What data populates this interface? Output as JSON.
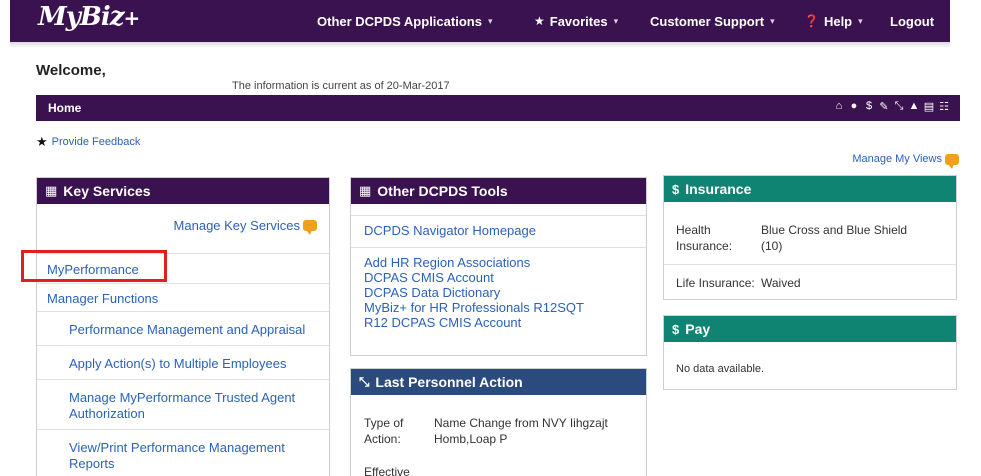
{
  "topbar": {
    "logo_main": "MyBiz",
    "logo_plus": "+",
    "menu": [
      {
        "label": "Other DCPDS Applications",
        "icon": ""
      },
      {
        "label": "Favorites",
        "icon": "star-icon"
      },
      {
        "label": "Customer Support",
        "icon": ""
      },
      {
        "label": "Help",
        "icon": "help-circle-icon"
      },
      {
        "label": "Logout",
        "icon": ""
      }
    ],
    "caret": "▾"
  },
  "header": {
    "welcome": "Welcome,",
    "as_of": "The information is current as of 20-Mar-2017"
  },
  "homebar": {
    "title": "Home",
    "icons": [
      "home-icon",
      "user-icon",
      "dollar-icon",
      "pen-icon",
      "personnel-action-icon",
      "thumbs-up-icon",
      "document-icon",
      "org-chart-icon"
    ]
  },
  "feedback": {
    "label": "Provide Feedback"
  },
  "manage_views": {
    "label": "Manage My Views"
  },
  "key_services": {
    "title": "Key Services",
    "manage_label": "Manage Key Services",
    "items": [
      {
        "label": "MyPerformance"
      },
      {
        "label": "Manager Functions"
      },
      {
        "label": "Performance Management and Appraisal"
      },
      {
        "label": "Apply Action(s) to Multiple Employees"
      },
      {
        "label": "Manage MyPerformance Trusted Agent Authorization"
      },
      {
        "label": "View/Print Performance Management Reports"
      }
    ]
  },
  "other_tools": {
    "title": "Other DCPDS Tools",
    "links": [
      "DCPDS Navigator Homepage",
      "Add HR Region Associations",
      "DCPAS CMIS Account",
      "DCPAS Data Dictionary",
      "MyBiz+ for HR Professionals R12SQT",
      "R12 DCPAS CMIS Account"
    ]
  },
  "last_action": {
    "title": "Last Personnel Action",
    "type_label": "Type of Action:",
    "type_value": "Name Change from NVY Iihgzajt Homb,Loap P",
    "effective_label": "Effective"
  },
  "insurance": {
    "title": "Insurance",
    "health_label": "Health Insurance:",
    "health_value": "Blue Cross and Blue Shield (10)",
    "life_label": "Life Insurance:",
    "life_value": "Waived"
  },
  "pay": {
    "title": "Pay",
    "message": "No data available."
  },
  "colors": {
    "brand_purple": "#3b1250",
    "teal": "#0f8473",
    "navy": "#2b4a7d",
    "link_blue": "#2b62b8",
    "highlight_red": "#e02020"
  }
}
